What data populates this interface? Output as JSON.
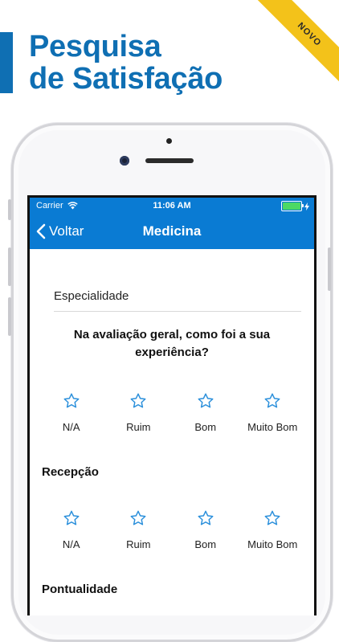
{
  "promo": {
    "title_line1": "Pesquisa",
    "title_line2": "de Satisfação",
    "badge": "NOVO",
    "accent_color": "#0f6fb3",
    "badge_color": "#f3c21a"
  },
  "status_bar": {
    "carrier": "Carrier",
    "time": "11:06 AM",
    "wifi_icon": "wifi-icon",
    "battery_icon": "battery-icon",
    "charging_icon": "charging-bolt-icon"
  },
  "nav": {
    "back_label": "Voltar",
    "title": "Medicina",
    "bar_color": "#0a7bd3"
  },
  "form": {
    "specialty_label": "Especialidade",
    "general_question": "Na avaliação geral, como foi a sua experiência?",
    "rating_options": [
      "N/A",
      "Ruim",
      "Bom",
      "Muito Bom"
    ],
    "sections": [
      {
        "title": "Recepção"
      },
      {
        "title": "Pontualidade"
      }
    ],
    "star_icon": "star-outline-icon"
  }
}
